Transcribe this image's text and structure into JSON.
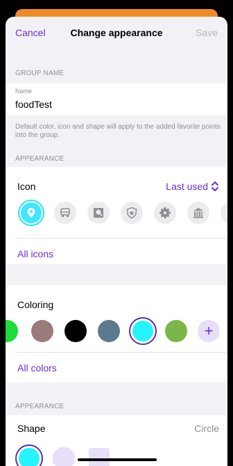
{
  "nav": {
    "cancel_label": "Cancel",
    "title": "Change appearance",
    "save_label": "Save"
  },
  "group_name": {
    "section_label": "GROUP NAME",
    "field_label": "Name",
    "field_value": "foodTest",
    "note": "Default color, icon and shape will apply to the added favorite points into the group."
  },
  "appearance_section_label": "APPEARANCE",
  "icon_row": {
    "title": "Icon",
    "value": "Last used",
    "icons": [
      "map-pin-icon",
      "car-front-icon",
      "photo-frame-icon",
      "badge-icon",
      "flower-icon",
      "museum-icon"
    ],
    "all_label": "All icons"
  },
  "coloring": {
    "title": "Coloring",
    "colors": [
      "#1ddc3a",
      "#9b7b79",
      "#000000",
      "#5b7a8f",
      "#25f4ff",
      "#7ab648"
    ],
    "selected_color": "#25f4ff",
    "all_label": "All colors"
  },
  "shape_section_label": "APPEARANCE",
  "shape": {
    "title": "Shape",
    "value": "Circle",
    "options": [
      "circle",
      "octagon",
      "square"
    ]
  },
  "accent_color": "#6b2fd6"
}
